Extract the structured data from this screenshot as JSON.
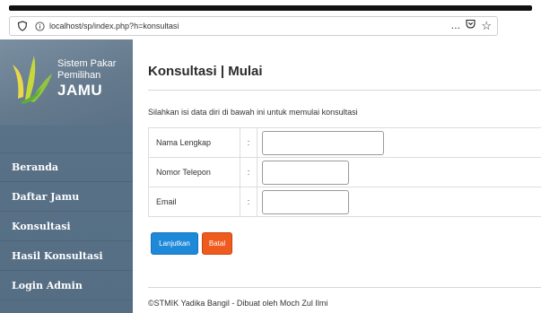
{
  "browser": {
    "url": "localhost/sp/index.php?h=konsultasi",
    "menu_glyph": "…",
    "pocket_glyph": "▿",
    "bookmark_glyph": "☆"
  },
  "sidebar": {
    "brand": {
      "line1": "Sistem Pakar",
      "line2": "Pemilihan",
      "line3": "JAMU",
      "logo_icon": "herb-leaves-icon"
    },
    "items": [
      {
        "label": "Beranda"
      },
      {
        "label": "Daftar Jamu"
      },
      {
        "label": "Konsultasi"
      },
      {
        "label": "Hasil Konsultasi"
      },
      {
        "label": "Login Admin"
      }
    ]
  },
  "main": {
    "title": "Konsultasi | Mulai",
    "intro": "Silahkan isi data diri di bawah ini untuk memulai konsultasi",
    "form": {
      "colon": ":",
      "fields": [
        {
          "label": "Nama Lengkap",
          "value": ""
        },
        {
          "label": "Nomor Telepon",
          "value": ""
        },
        {
          "label": "Email",
          "value": ""
        }
      ]
    },
    "buttons": {
      "submit": "Lanjutkan",
      "cancel": "Batal"
    },
    "footer": "©STMIK Yadika Bangil - Dibuat oleh Moch Zul Ilmi"
  },
  "colors": {
    "sidebar": "#5a7388",
    "submit_button": "#1e88d9",
    "cancel_button": "#ef5a1e"
  }
}
